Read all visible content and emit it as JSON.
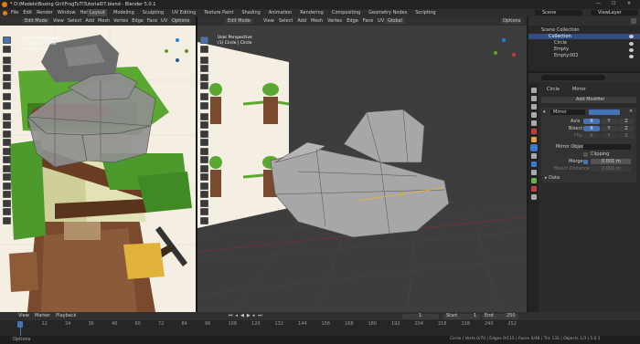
{
  "window": {
    "title": "* D:\\Models\\Boxing Girl\\FrogTuT\\Tutorial07.blend - Blender 5.0.1"
  },
  "menu": [
    "File",
    "Edit",
    "Render",
    "Window",
    "Help"
  ],
  "workspaces": [
    "Layout",
    "Modeling",
    "Sculpting",
    "UV Editing",
    "Texture Paint",
    "Shading",
    "Animation",
    "Rendering",
    "Compositing",
    "Geometry Nodes",
    "Scripting"
  ],
  "scene": {
    "label": "Scene",
    "view_layer": "ViewLayer"
  },
  "left_view": {
    "mode": "Edit Mode",
    "menu": [
      "View",
      "Select",
      "Add",
      "Mesh",
      "Vertex",
      "Edge",
      "Face",
      "UV"
    ],
    "overlay_lines": [
      "Right Orthographic",
      "(1) Circle | Circle",
      "Centimeters"
    ],
    "options": "Options"
  },
  "right_view": {
    "mode": "Edit Mode",
    "menu": [
      "View",
      "Select",
      "Add",
      "Mesh",
      "Vertex",
      "Edge",
      "Face",
      "UV"
    ],
    "transform": "Global",
    "overlay_lines": [
      "User Perspective",
      "(1) Circle | Circle"
    ],
    "options": "Options"
  },
  "outliner": {
    "root": "Scene Collection",
    "items": [
      "Collection",
      "Circle",
      "Empty",
      "Empty.002"
    ]
  },
  "properties": {
    "breadcrumb_obj": "Circle",
    "breadcrumb_mod": "Mirror",
    "add_modifier": "Add Modifier",
    "modifier_name": "Mirror",
    "axis_label": "Axis",
    "bisect_label": "Bisect",
    "flip_label": "Flip",
    "xyz": [
      "X",
      "Y",
      "Z"
    ],
    "mirror_object_label": "Mirror Object",
    "clipping_label": "Clipping",
    "merge_label": "Merge",
    "merge_value": "0.001 m",
    "bisect_distance_label": "Bisect Distance",
    "bisect_distance_value": "0.001 m",
    "data_label": "Data"
  },
  "timeline": {
    "menu": [
      "View",
      "Marker",
      "Playback"
    ],
    "current_frame": "1",
    "start_label": "Start",
    "start_value": "1",
    "end_label": "End",
    "end_value": "250",
    "ticks": [
      "1",
      "12",
      "24",
      "36",
      "48",
      "60",
      "72",
      "84",
      "96",
      "108",
      "120",
      "132",
      "144",
      "156",
      "168",
      "180",
      "192",
      "204",
      "216",
      "228",
      "240",
      "252"
    ]
  },
  "status": {
    "left": "Options",
    "right": "Circle | Verts 0/70 | Edges 0/115 | Faces 0/48 | Tris 132 | Objects 1/3 | 5.0.1"
  },
  "colors": {
    "accent": "#4772b3",
    "header": "#303030",
    "panel": "#2b2b2b",
    "viewport": "#3d3d3d",
    "reference": "#f4efe2"
  }
}
